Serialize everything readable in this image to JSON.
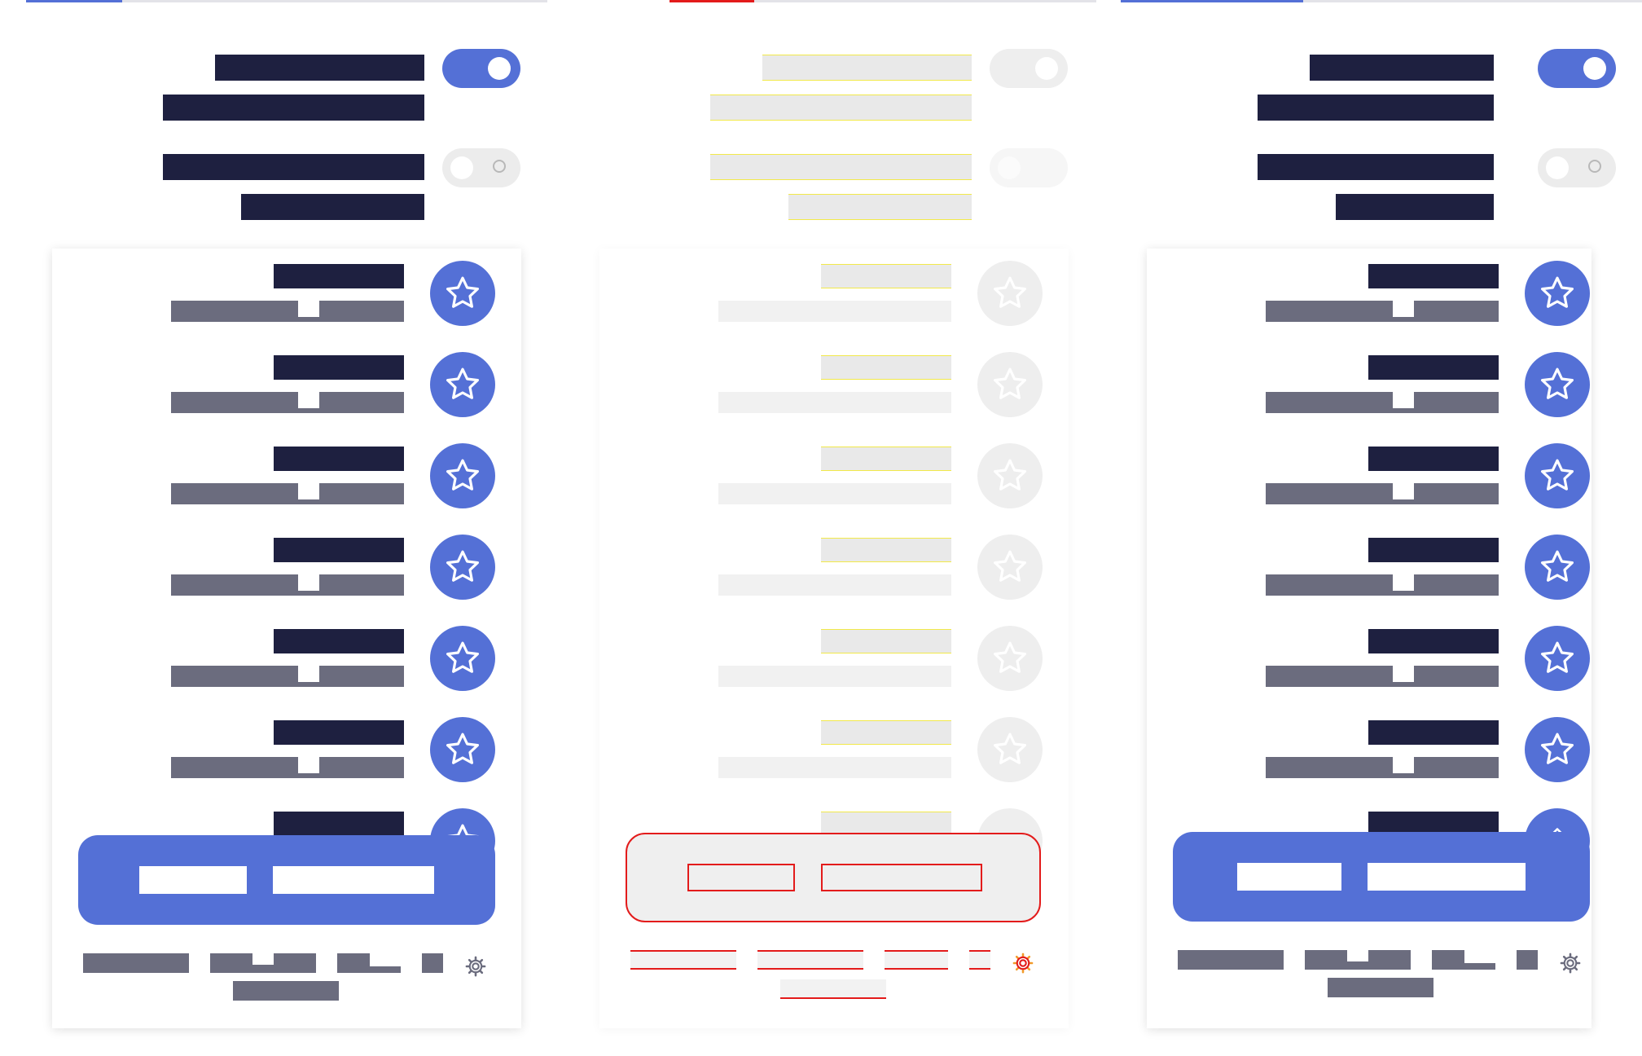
{
  "colors": {
    "accent": "#5470d6",
    "text_dark": "#1e2040",
    "text_muted": "#6b6c7e",
    "toggle_off": "#ececec",
    "panel_bg": "#ffffff",
    "placeholder": "#e9e9e9",
    "outline_yellow": "#f2e94a",
    "outline_red": "#e31b1b",
    "top_red": "#e31b1b"
  },
  "variants": [
    {
      "name": "default",
      "toggles": [
        {
          "on": true
        },
        {
          "on": false
        }
      ],
      "list_count": 7
    },
    {
      "name": "placeholder",
      "toggles": [
        {
          "on": true
        },
        {
          "on": false
        }
      ],
      "list_count": 7
    },
    {
      "name": "default-alt",
      "toggles": [
        {
          "on": true
        },
        {
          "on": false
        }
      ],
      "list_count": 7
    }
  ],
  "icons": {
    "star": "star-icon",
    "gear": "gear-icon",
    "chevron": "chevron-up-icon"
  }
}
